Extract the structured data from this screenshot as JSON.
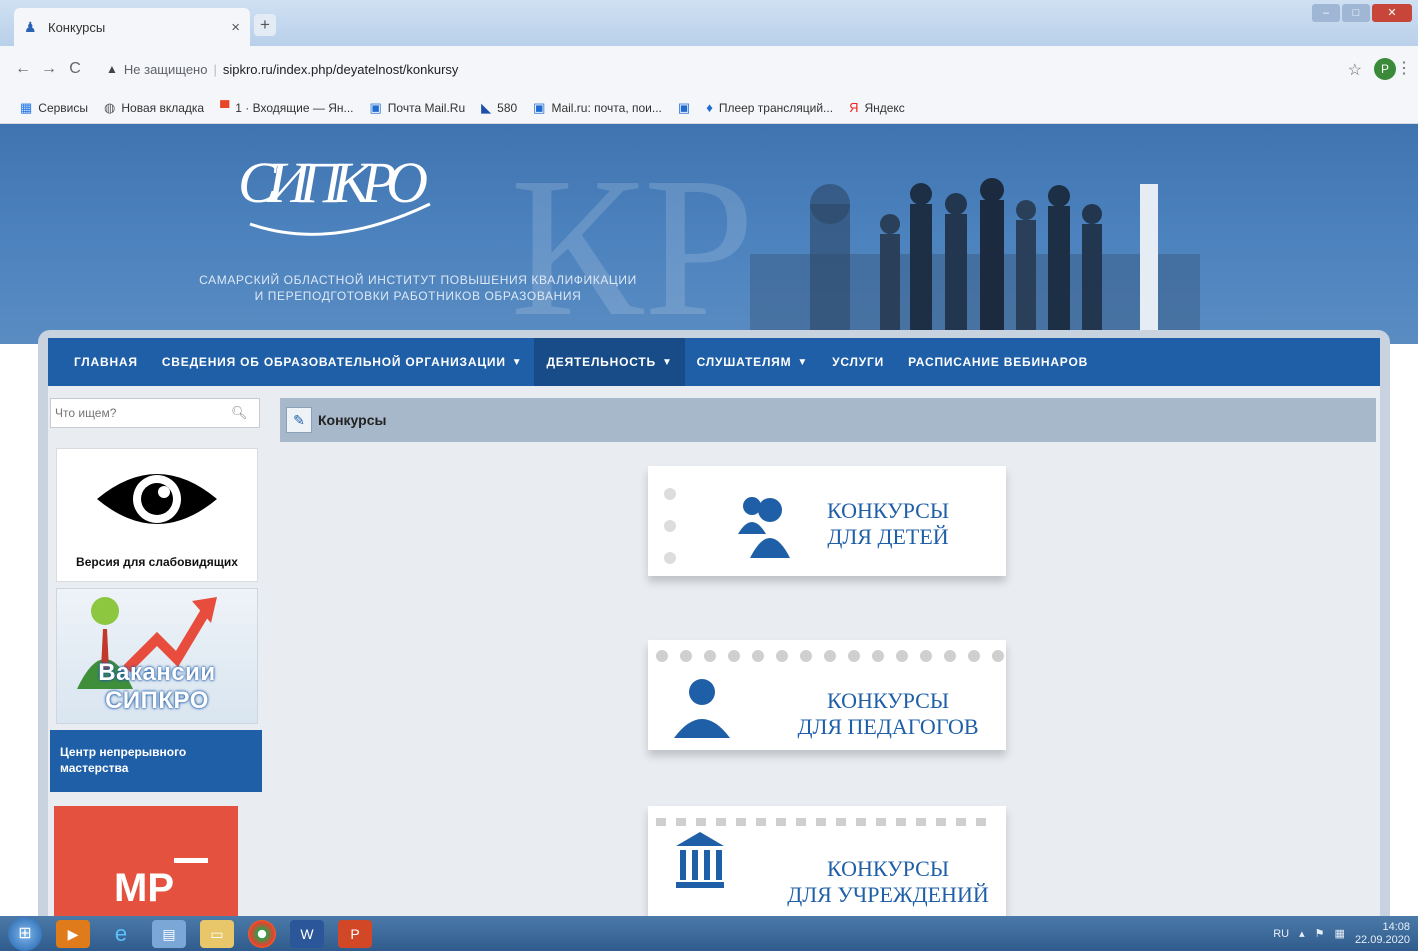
{
  "browser": {
    "tab_title": "Конкурсы",
    "address_warning": "Не защищено",
    "url": "sipkro.ru/index.php/deyatelnost/konkursy",
    "profile_initial": "P",
    "bookmarks": [
      {
        "label": "Сервисы",
        "icon": "apps-icon"
      },
      {
        "label": "Новая вкладка",
        "icon": "globe-icon"
      },
      {
        "label": "1 · Входящие — Ян...",
        "icon": "mail-icon"
      },
      {
        "label": "Почта Mail.Ru",
        "icon": "mailru-icon"
      },
      {
        "label": "580",
        "icon": "shoe-icon"
      },
      {
        "label": "Mail.ru: почта, пои...",
        "icon": "mailru-icon"
      },
      {
        "label": "",
        "icon": "mailru-icon"
      },
      {
        "label": "Плеер трансляций...",
        "icon": "player-icon"
      },
      {
        "label": "Яндекс",
        "icon": "yandex-icon"
      }
    ]
  },
  "site": {
    "logo_text": "СИПКРО",
    "institute_line1": "САМАРСКИЙ ОБЛАСТНОЙ ИНСТИТУТ ПОВЫШЕНИЯ КВАЛИФИКАЦИИ",
    "institute_line2": "И ПЕРЕПОДГОТОВКИ РАБОТНИКОВ ОБРАЗОВАНИЯ",
    "menu": [
      {
        "label": "ГЛАВНАЯ",
        "caret": false,
        "active": false
      },
      {
        "label": "СВЕДЕНИЯ ОБ ОБРАЗОВАТЕЛЬНОЙ ОРГАНИЗАЦИИ",
        "caret": true,
        "active": false
      },
      {
        "label": "ДЕЯТЕЛЬНОСТЬ",
        "caret": true,
        "active": true
      },
      {
        "label": "СЛУШАТЕЛЯМ",
        "caret": true,
        "active": false
      },
      {
        "label": "УСЛУГИ",
        "caret": false,
        "active": false
      },
      {
        "label": "РАСПИСАНИЕ ВЕБИНАРОВ",
        "caret": false,
        "active": false
      }
    ],
    "search_placeholder": "Что ищем?",
    "blind_label": "Версия для слабовидящих",
    "vacancy_label": "Вакансии СИПКРО",
    "center_label": "Центр непрерывного мастерства",
    "mp_label": "МР",
    "page_title": "Конкурсы",
    "cards": [
      {
        "line1": "КОНКУРСЫ",
        "line2": "ДЛЯ ДЕТЕЙ"
      },
      {
        "line1": "КОНКУРСЫ",
        "line2": "ДЛЯ ПЕДАГОГОВ"
      },
      {
        "line1": "КОНКУРСЫ",
        "line2": "ДЛЯ УЧРЕЖДЕНИЙ"
      }
    ]
  },
  "taskbar": {
    "lang": "RU",
    "time": "14:08",
    "date": "22.09.2020"
  },
  "colors": {
    "menu_blue": "#1f5fa8",
    "header_blue": "#4d83be",
    "card_text": "#1f5fa8",
    "mp_red": "#e4513e"
  }
}
